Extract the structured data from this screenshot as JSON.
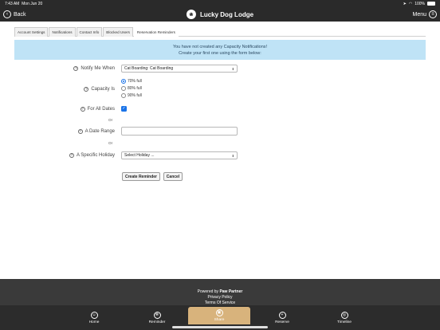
{
  "status_bar": {
    "time": "7:43 AM",
    "date": "Mon Jun 20",
    "battery": "100%"
  },
  "nav": {
    "back_label": "Back",
    "title": "Lucky Dog Lodge",
    "menu_label": "Menu"
  },
  "tabs": [
    {
      "label": "Account Settings"
    },
    {
      "label": "Notifications"
    },
    {
      "label": "Contact Info"
    },
    {
      "label": "Blocked Users"
    },
    {
      "label": "Reservation Reminders"
    }
  ],
  "alert": {
    "line1": "You have not created any Capacity Notifications!",
    "line2": "Create your first one using the form below:"
  },
  "form": {
    "notify_label": "Notify Me When",
    "notify_value": "Cat Boarding: Cat Boarding",
    "capacity_label": "Capacity Is",
    "capacity_options": [
      {
        "label": "70% full",
        "selected": true
      },
      {
        "label": "80% full",
        "selected": false
      },
      {
        "label": "90% full",
        "selected": false
      }
    ],
    "all_dates_label": "For All Dates",
    "all_dates_checked": true,
    "or_text": "Or",
    "date_range_label": "A Date Range",
    "date_range_value": "",
    "holiday_label": "A Specific Holiday",
    "holiday_value": "Select Holiday ...",
    "help_glyph": "?",
    "create_button": "Create Reminder",
    "cancel_button": "Cancel"
  },
  "footer": {
    "powered_prefix": "Powered by",
    "powered_brand": "Paw Partner",
    "privacy": "Privacy Policy",
    "terms": "Terms Of Service"
  },
  "tabbar": [
    {
      "label": "Home",
      "icon": "home-icon",
      "active": false
    },
    {
      "label": "Reminder",
      "icon": "reminder-icon",
      "active": false
    },
    {
      "label": "Share",
      "icon": "share-icon",
      "active": true
    },
    {
      "label": "Reserve",
      "icon": "reserve-icon",
      "active": false
    },
    {
      "label": "Timeline",
      "icon": "timeline-icon",
      "active": false
    }
  ],
  "colors": {
    "accent": "#1a73e8",
    "alert_bg": "#bfe3f6",
    "active_tab": "#d8b37c",
    "bar_bg": "#2a2a2a"
  }
}
